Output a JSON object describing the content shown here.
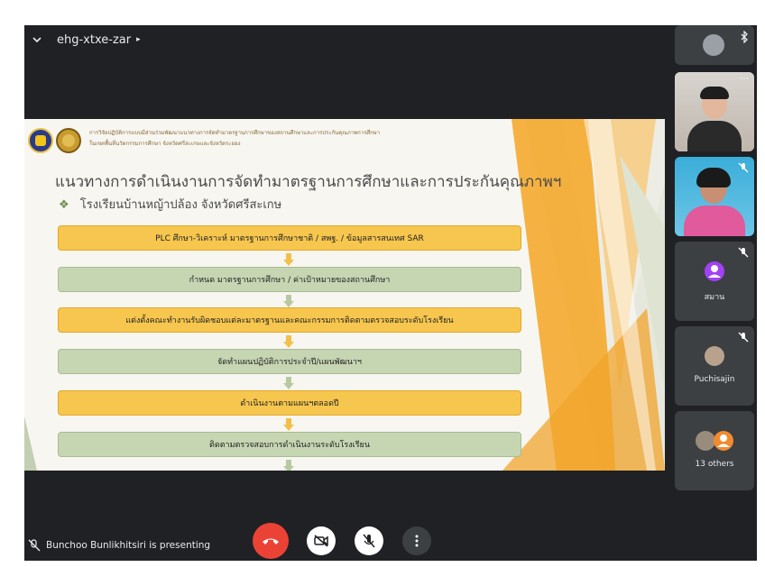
{
  "meeting": {
    "code": "ehg-xtxe-zar"
  },
  "slide": {
    "header_line1": "การวิจัยปฏิบัติการแบบมีส่วนร่วมพัฒนาแนวทางการจัดทำมาตรฐานการศึกษาของสถานศึกษาและการประกันคุณภาพการศึกษา",
    "header_line2": "ในเขตพื้นที่นวัตกรรมการศึกษา จังหวัดศรีสะเกษและจังหวัดระยอง",
    "title": "แนวทางการดำเนินงานการจัดทำมาตรฐานการศึกษาและการประกันคุณภาพฯ",
    "subtitle": "โรงเรียนบ้านหญ้าปล้อง จังหวัดศรีสะเกษ",
    "steps": [
      {
        "text": "PLC ศึกษา-วิเคราะห์ มาตรฐานการศึกษาชาติ / สพฐ. / ข้อมูลสารสนเทศ SAR",
        "color": "#f6c64e"
      },
      {
        "text": "กำหนด มาตรฐานการศึกษา / ค่าเป้าหมายของสถานศึกษา",
        "color": "#c6d5b2"
      },
      {
        "text": "แต่งตั้งคณะทำงานรับผิดชอบแต่ละมาตรฐานและคณะกรรมการติดตามตรวจสอบระดับโรงเรียน",
        "color": "#f6c64e"
      },
      {
        "text": "จัดทำแผนปฏิบัติการประจำปี/แผนพัฒนาฯ",
        "color": "#c6d5b2"
      },
      {
        "text": "ดำเนินงานตามแผนฯตลอดปี",
        "color": "#f6c64e"
      },
      {
        "text": "ติดตามตรวจสอบการดำเนินงานระดับโรงเรียน",
        "color": "#c6d5b2"
      }
    ]
  },
  "participants": {
    "tile_samarn": "สมาน",
    "tile_puchisajin": "Puchisajin",
    "tile_others": "13 others"
  },
  "status": {
    "presenting": "Bunchoo Bunlikhitsiri is presenting"
  },
  "colors": {
    "end_call": "#ea4335",
    "tile_bg": "#3c4043",
    "meeting_bg": "#202124",
    "samarn_avatar": "#a142f4",
    "others_avatar": "#f28b30"
  },
  "icons": [
    "chevron-down-icon",
    "bluetooth-icon",
    "more-options-icon",
    "mic-off-icon",
    "present-icon",
    "end-call-icon",
    "camera-off-icon",
    "more-vert-icon"
  ]
}
